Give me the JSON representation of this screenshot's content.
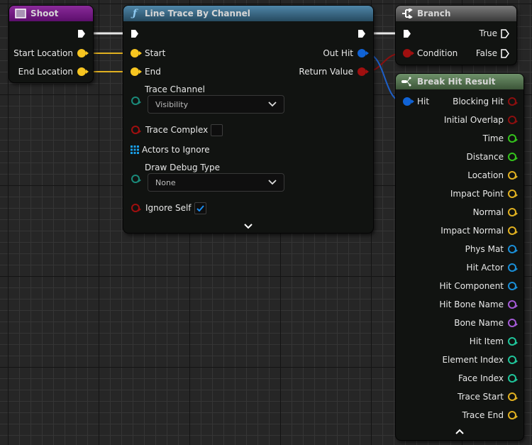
{
  "nodes": {
    "shoot": {
      "title": "Shoot",
      "icon": "event-icon",
      "header_color": "#7a1f8a",
      "outputs": [
        "Start Location",
        "End Location"
      ]
    },
    "line_trace": {
      "title": "Line Trace By Channel",
      "icon": "function-icon",
      "header_color": "#3f6f8e",
      "inputs": {
        "start": "Start",
        "end": "End",
        "trace_channel_label": "Trace Channel",
        "trace_channel_value": "Visibility",
        "trace_complex_label": "Trace Complex",
        "trace_complex_checked": false,
        "actors_to_ignore_label": "Actors to Ignore",
        "draw_debug_type_label": "Draw Debug Type",
        "draw_debug_type_value": "None",
        "ignore_self_label": "Ignore Self",
        "ignore_self_checked": true
      },
      "outputs": {
        "out_hit": "Out Hit",
        "return_value": "Return Value"
      }
    },
    "branch": {
      "title": "Branch",
      "icon": "branch-icon",
      "header_color": "#5a5a5a",
      "condition": "Condition",
      "true_label": "True",
      "false_label": "False"
    },
    "break_hit": {
      "title": "Break Hit Result",
      "icon": "break-struct-icon",
      "header_color": "#5a7a55",
      "input": "Hit",
      "outputs": [
        {
          "label": "Blocking Hit",
          "color": "#8c0f0f"
        },
        {
          "label": "Initial Overlap",
          "color": "#8c0f0f"
        },
        {
          "label": "Time",
          "color": "#34c21c"
        },
        {
          "label": "Distance",
          "color": "#34c21c"
        },
        {
          "label": "Location",
          "color": "#e0b020"
        },
        {
          "label": "Impact Point",
          "color": "#e0b020"
        },
        {
          "label": "Normal",
          "color": "#e0b020"
        },
        {
          "label": "Impact Normal",
          "color": "#e0b020"
        },
        {
          "label": "Phys Mat",
          "color": "#1a8ed6"
        },
        {
          "label": "Hit Actor",
          "color": "#1a8ed6"
        },
        {
          "label": "Hit Component",
          "color": "#1a8ed6"
        },
        {
          "label": "Hit Bone Name",
          "color": "#a45ad6"
        },
        {
          "label": "Bone Name",
          "color": "#a45ad6"
        },
        {
          "label": "Hit Item",
          "color": "#1fc59a"
        },
        {
          "label": "Element Index",
          "color": "#1fc59a"
        },
        {
          "label": "Face Index",
          "color": "#1fc59a"
        },
        {
          "label": "Trace Start",
          "color": "#e0b020"
        },
        {
          "label": "Trace End",
          "color": "#e0b020"
        }
      ]
    }
  },
  "pin_colors": {
    "vector": "#f7c520",
    "struct": "#1063d6",
    "bool": "#a00f0f",
    "byte": "#1a8a7a",
    "array_object": "#1a9ee6",
    "exec": "#ffffff"
  }
}
